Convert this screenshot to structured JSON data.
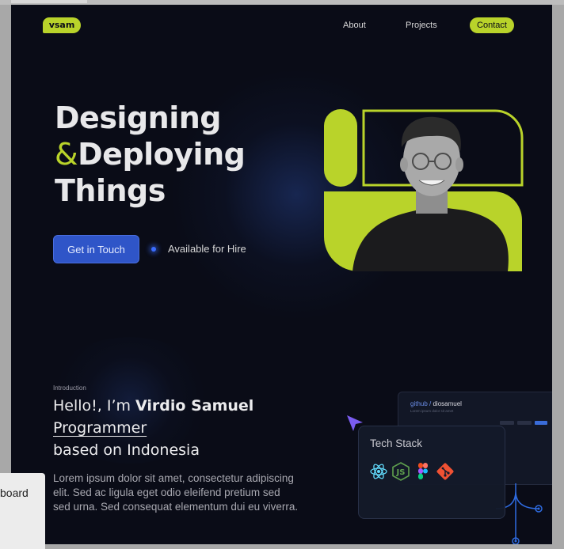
{
  "header": {
    "logo": "vsam",
    "nav": {
      "about": "About",
      "projects": "Projects",
      "contact": "Contact"
    }
  },
  "hero": {
    "title_line1": "Designing",
    "title_amp": "&",
    "title_line2": "Deploying",
    "title_line3": "Things",
    "cta_label": "Get in Touch",
    "status": "Available for Hire"
  },
  "intro": {
    "label": "Introduction",
    "greeting": "Hello!, I’m ",
    "name": "Virdio Samuel",
    "role": "Programmer",
    "location": "based on Indonesia",
    "body": "Lorem ipsum dolor sit amet, consectetur adipiscing elit. Sed ac ligula eget odio eleifend pretium sed sed urna. Sed consequat elementum dui eu viverra."
  },
  "github_card": {
    "prefix": "github / ",
    "user": "diosamuel",
    "subtitle": "Lorem ipsum dolor sit amet"
  },
  "tech_stack": {
    "title": "Tech Stack",
    "icons": [
      "react-icon",
      "nodejs-icon",
      "figma-icon",
      "git-icon"
    ]
  },
  "dock": {
    "label": "board"
  },
  "colors": {
    "accent": "#b9d32a",
    "background": "#0a0c17",
    "cta": "#2f55c8",
    "status_dot": "#3a6cff"
  }
}
